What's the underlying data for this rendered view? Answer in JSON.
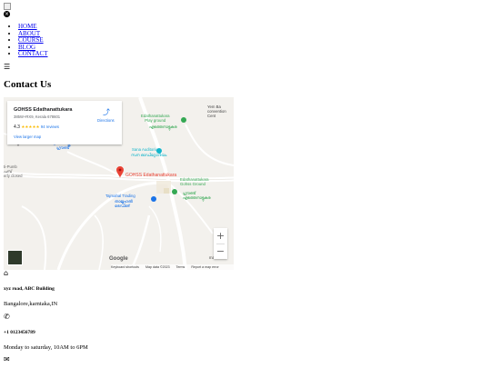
{
  "nav": {
    "items": [
      {
        "label": "HOME"
      },
      {
        "label": "ABOUT"
      },
      {
        "label": "COURSE"
      },
      {
        "label": "BLOG"
      },
      {
        "label": "CONTACT"
      }
    ],
    "close_glyph": "×",
    "menu_glyph": "☰"
  },
  "page": {
    "title": "Contact Us"
  },
  "map": {
    "place_name": "GOHSS Edathanattukara",
    "address": "385W+RX9, Kerala 678601",
    "rating": "4.3",
    "stars": "★★★★★",
    "reviews": "94 reviews",
    "view_larger": "View larger map",
    "directions": "Directions",
    "pin_label": "GOHSS Edathanattukara",
    "labels": {
      "convention": "Yem Ba\nconvention Cent",
      "play_ground": "Edathanattukara\nPlay ground",
      "play_ground_ml": "എടത്തനാട്ടുകര",
      "school_ml": "ഗവ. സ്കൂൾ\nഗ്രൗണ്ട്",
      "sana": "Sana Auditorium",
      "sana_ml": "സന ഓഡിറ്റോറിയം",
      "gohss_ground": "Edathanattukara\nGohss Ground",
      "gohss_ground_ml": "ഗ്രൗണ്ട്\nഎടത്തനാട്ടുകര",
      "tajmahal": "Tajmahal Trading",
      "tajmahal_ml": "താജ്മഹൽ\nട്രേഡിങ്",
      "west": "ti-Pumb\nപമ്പ്\nerly closed",
      "malabar": "malabar",
      "zoom_in": "+",
      "zoom_out": "−",
      "google": "Google"
    },
    "attribution": {
      "shortcuts": "Keyboard shortcuts",
      "data": "Map data ©2023",
      "terms": "Terms",
      "report": "Report a map error"
    },
    "colors": {
      "pin": "#ea4335",
      "poi_green": "#34a853",
      "poi_teal": "#12b5cb",
      "poi_blue": "#1a73e8"
    }
  },
  "contact": {
    "address_bold": "xyz road, ABC Building",
    "address_city": "Bangalore,karntaka,IN",
    "phone": "+1 0123456789",
    "hours": "Monday to saturday, 10AM to 6PM",
    "icons": {
      "home": "home-icon",
      "phone": "phone-icon",
      "mail": "envelope-icon"
    }
  }
}
